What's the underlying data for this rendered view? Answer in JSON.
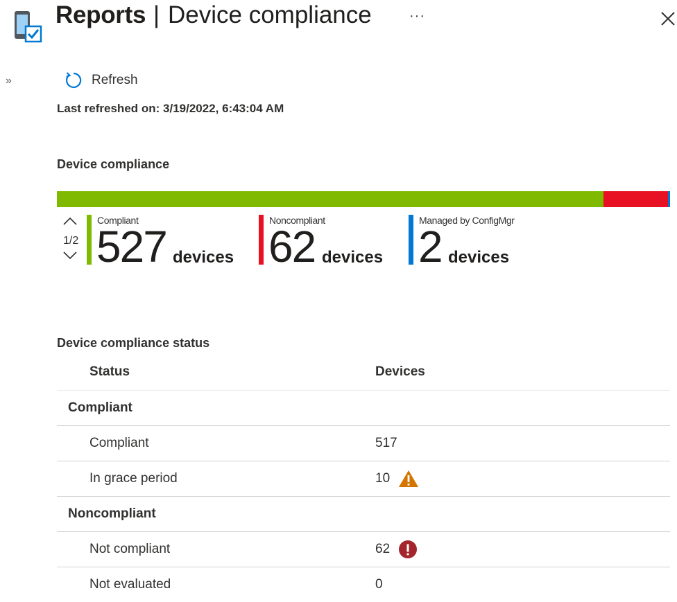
{
  "header": {
    "title_main": "Reports",
    "title_separator": "|",
    "title_sub": "Device compliance",
    "more_label": "···",
    "app_icon": "device-compliance-icon",
    "close_icon": "close-icon"
  },
  "toolbar": {
    "expand_label": "»",
    "refresh_label": "Refresh",
    "refresh_icon": "refresh-icon"
  },
  "last_refreshed": "Last refreshed on: 3/19/2022, 6:43:04 AM",
  "summary": {
    "title": "Device compliance",
    "bar": [
      {
        "name": "Compliant",
        "value": 527,
        "color": "#7fba00"
      },
      {
        "name": "Noncompliant",
        "value": 62,
        "color": "#e81123"
      },
      {
        "name": "Managed by ConfigMgr",
        "value": 2,
        "color": "#0078d4"
      }
    ],
    "pager": "1/2",
    "stats": [
      {
        "label": "Compliant",
        "count": "527",
        "unit": "devices",
        "color": "#7fba00"
      },
      {
        "label": "Noncompliant",
        "count": "62",
        "unit": "devices",
        "color": "#e81123"
      },
      {
        "label": "Managed by ConfigMgr",
        "count": "2",
        "unit": "devices",
        "color": "#0078d4"
      }
    ]
  },
  "status_table": {
    "title": "Device compliance status",
    "columns": [
      "Status",
      "Devices"
    ],
    "groups": [
      {
        "name": "Compliant",
        "rows": [
          {
            "status": "Compliant",
            "devices": "517",
            "icon": ""
          },
          {
            "status": "In grace period",
            "devices": "10",
            "icon": "warning-icon"
          }
        ]
      },
      {
        "name": "Noncompliant",
        "rows": [
          {
            "status": "Not compliant",
            "devices": "62",
            "icon": "error-icon"
          },
          {
            "status": "Not evaluated",
            "devices": "0",
            "icon": ""
          }
        ]
      }
    ]
  },
  "colors": {
    "warning": "#d47500",
    "error": "#a4262c",
    "refresh": "#0078d4"
  }
}
